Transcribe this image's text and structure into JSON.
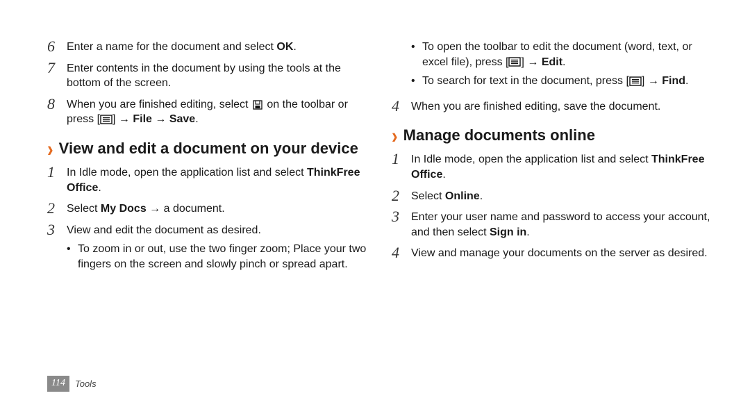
{
  "left": {
    "prevSteps": [
      {
        "n": "6",
        "parts": [
          {
            "t": "Enter a name for the document and select "
          },
          {
            "t": "OK",
            "b": true
          },
          {
            "t": "."
          }
        ]
      },
      {
        "n": "7",
        "parts": [
          {
            "t": "Enter contents in the document by using the tools at the bottom of the screen."
          }
        ]
      },
      {
        "n": "8",
        "parts": [
          {
            "t": "When you are finished editing, select "
          },
          {
            "icon": "save-icon"
          },
          {
            "t": " on the toolbar or press ["
          },
          {
            "icon": "menu-icon"
          },
          {
            "t": "] → "
          },
          {
            "t": "File",
            "b": true
          },
          {
            "t": " → "
          },
          {
            "t": "Save",
            "b": true
          },
          {
            "t": "."
          }
        ]
      }
    ],
    "heading": "View and edit a document on your device",
    "steps": [
      {
        "n": "1",
        "parts": [
          {
            "t": "In Idle mode, open the application list and select "
          },
          {
            "t": "ThinkFree Office",
            "b": true
          },
          {
            "t": "."
          }
        ]
      },
      {
        "n": "2",
        "parts": [
          {
            "t": "Select "
          },
          {
            "t": "My Docs",
            "b": true
          },
          {
            "t": " → a document."
          }
        ]
      },
      {
        "n": "3",
        "parts": [
          {
            "t": "View and edit the document as desired."
          }
        ],
        "sub": [
          {
            "parts": [
              {
                "t": "To zoom in or out, use the two finger zoom; Place your two fingers on the screen and slowly pinch or spread apart."
              }
            ]
          }
        ]
      }
    ]
  },
  "right": {
    "contSub": [
      {
        "parts": [
          {
            "t": "To open the toolbar to edit the document (word, text, or excel file), press ["
          },
          {
            "icon": "menu-icon"
          },
          {
            "t": "] → "
          },
          {
            "t": "Edit",
            "b": true
          },
          {
            "t": "."
          }
        ]
      },
      {
        "parts": [
          {
            "t": "To search for text in the document, press ["
          },
          {
            "icon": "menu-icon"
          },
          {
            "t": "] → "
          },
          {
            "t": "Find",
            "b": true
          },
          {
            "t": "."
          }
        ]
      }
    ],
    "contStep": {
      "n": "4",
      "parts": [
        {
          "t": "When you are finished editing, save the document."
        }
      ]
    },
    "heading": "Manage documents online",
    "steps": [
      {
        "n": "1",
        "parts": [
          {
            "t": "In Idle mode, open the application list and select "
          },
          {
            "t": "ThinkFree Office",
            "b": true
          },
          {
            "t": "."
          }
        ]
      },
      {
        "n": "2",
        "parts": [
          {
            "t": "Select "
          },
          {
            "t": "Online",
            "b": true
          },
          {
            "t": "."
          }
        ]
      },
      {
        "n": "3",
        "parts": [
          {
            "t": "Enter your user name and password to access your account, and then select "
          },
          {
            "t": "Sign in",
            "b": true
          },
          {
            "t": "."
          }
        ]
      },
      {
        "n": "4",
        "parts": [
          {
            "t": "View and manage your documents on the server as desired."
          }
        ]
      }
    ]
  },
  "footer": {
    "page": "114",
    "section": "Tools"
  }
}
